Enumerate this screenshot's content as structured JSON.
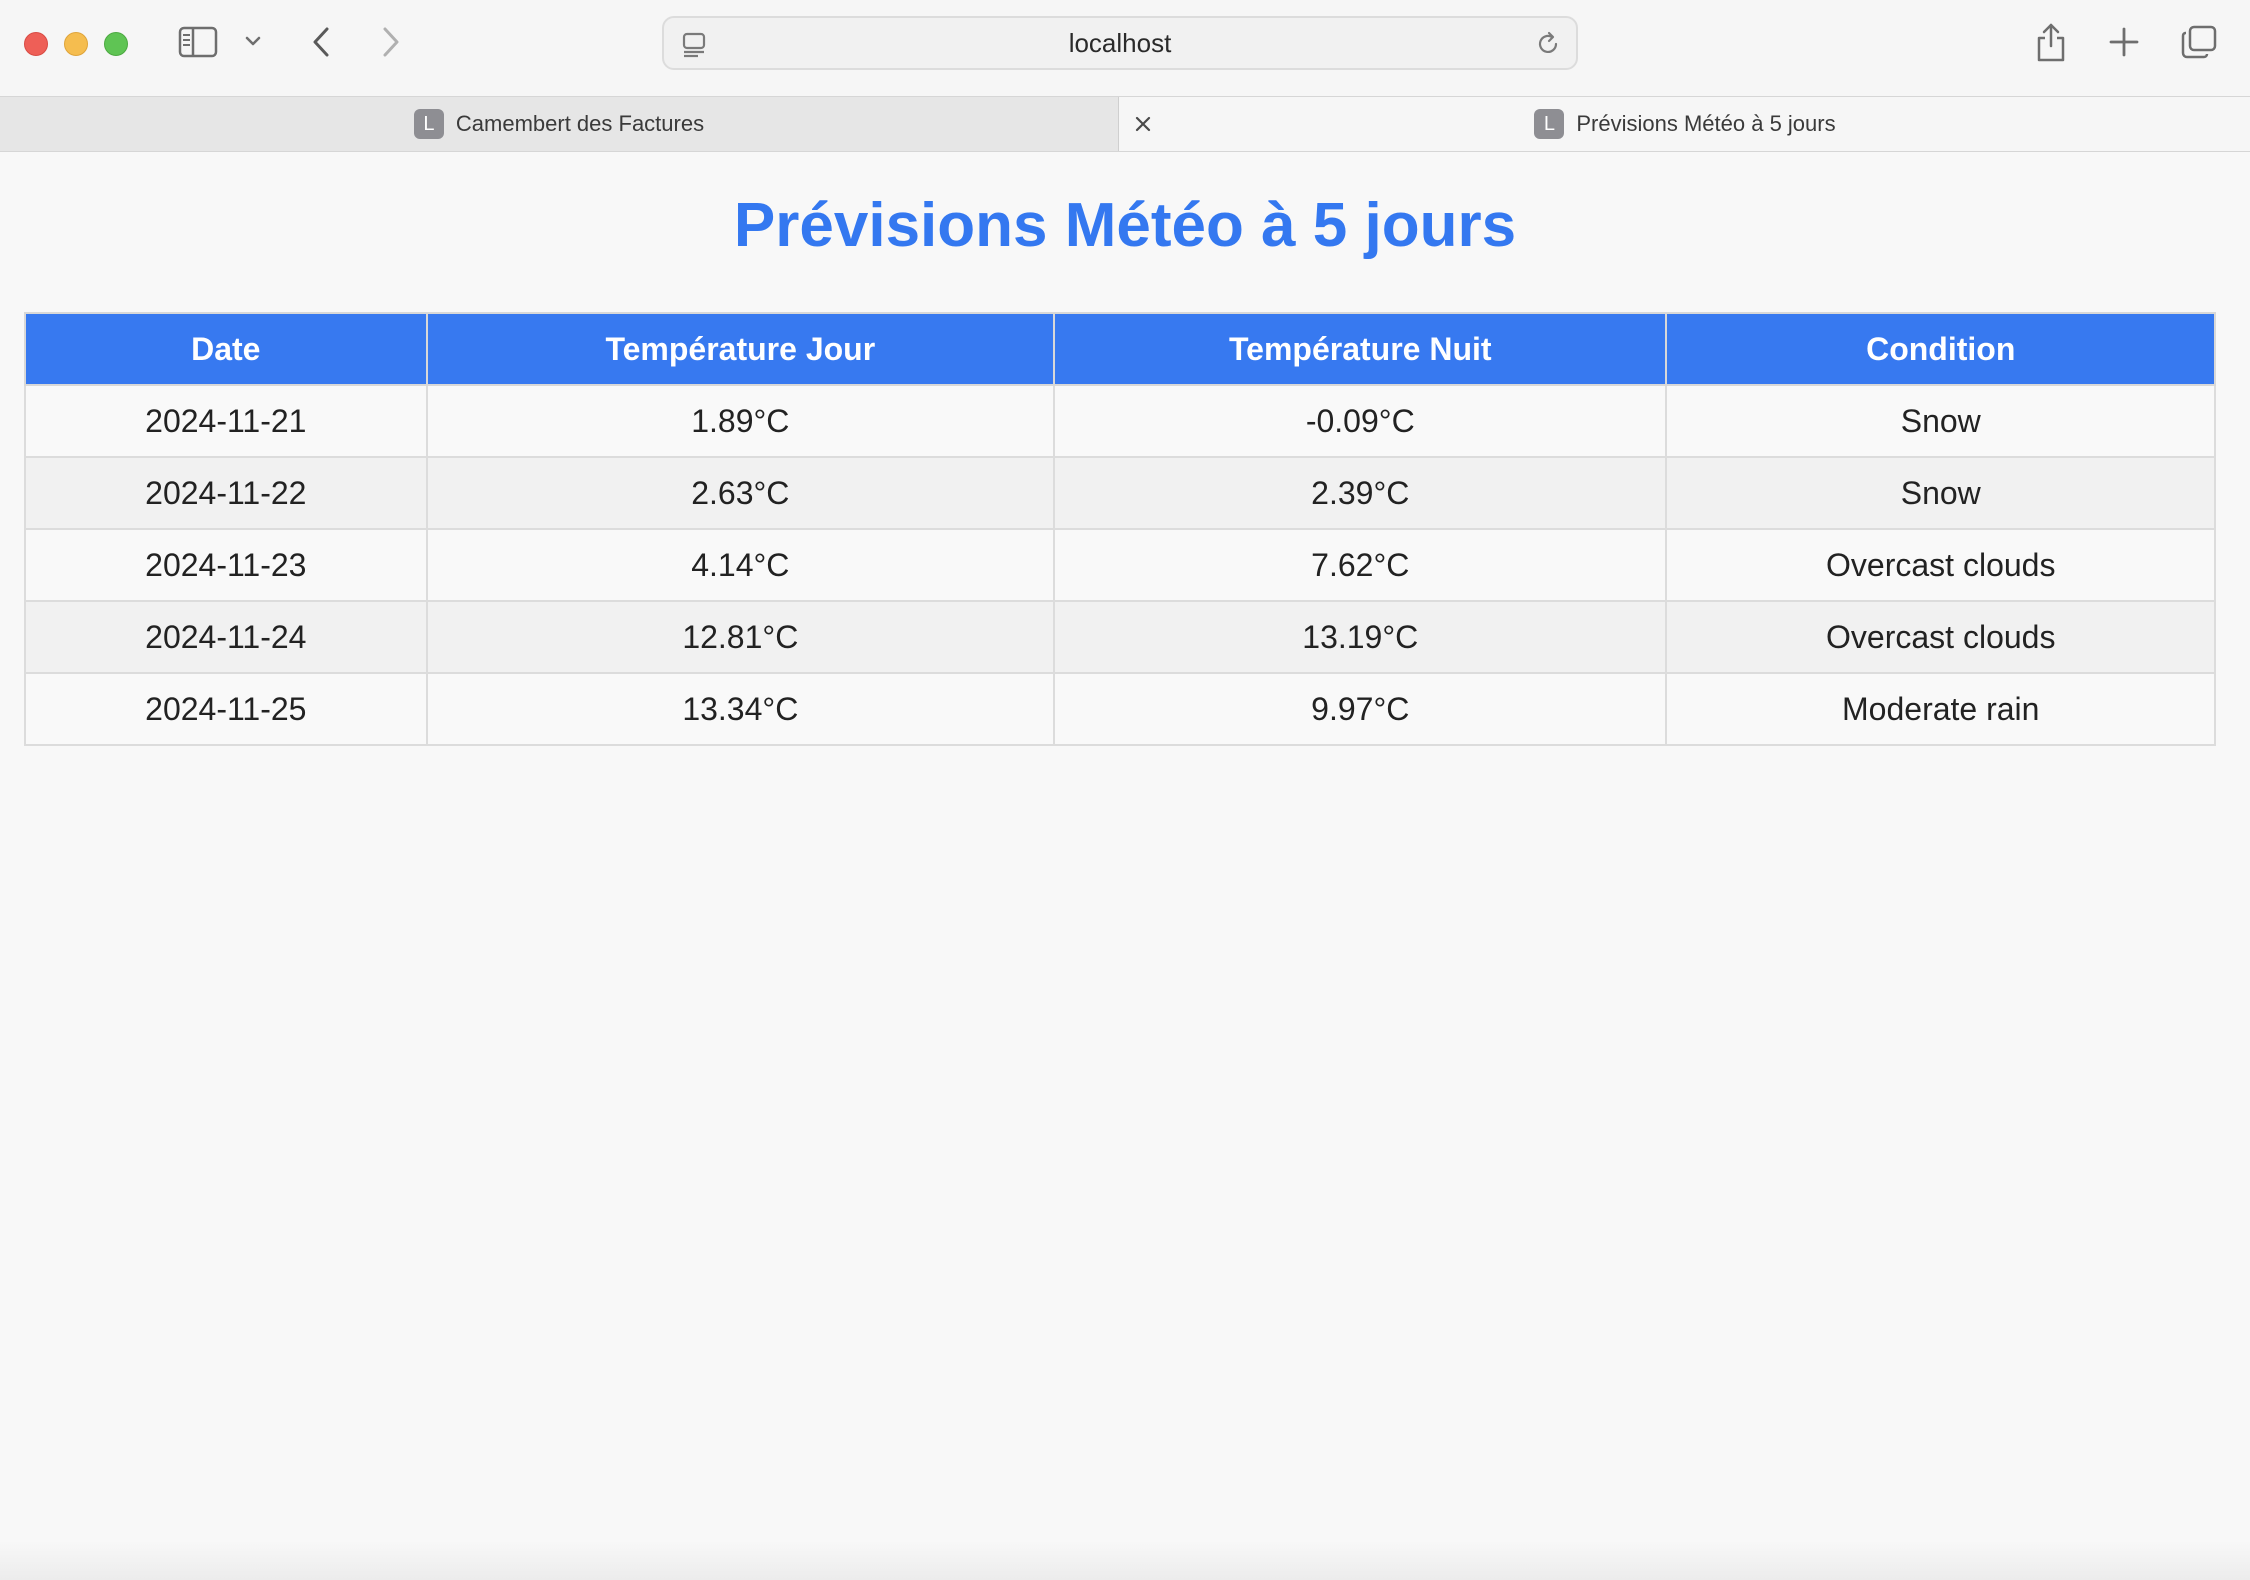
{
  "browser": {
    "url": "localhost",
    "tabs": [
      {
        "label": "Camembert des Factures",
        "favicon_letter": "L",
        "active": false
      },
      {
        "label": "Prévisions Météo à 5 jours",
        "favicon_letter": "L",
        "active": true
      }
    ],
    "colors": {
      "close": "#ee5f57",
      "minimize": "#f5bd4f",
      "maximize": "#5fc454"
    }
  },
  "page": {
    "title": "Prévisions Météo à 5 jours",
    "accent_color": "#3779f0",
    "table": {
      "headers": [
        "Date",
        "Température Jour",
        "Température Nuit",
        "Condition"
      ],
      "rows": [
        [
          "2024-11-21",
          "1.89°C",
          "-0.09°C",
          "Snow"
        ],
        [
          "2024-11-22",
          "2.63°C",
          "2.39°C",
          "Snow"
        ],
        [
          "2024-11-23",
          "4.14°C",
          "7.62°C",
          "Overcast clouds"
        ],
        [
          "2024-11-24",
          "12.81°C",
          "13.19°C",
          "Overcast clouds"
        ],
        [
          "2024-11-25",
          "13.34°C",
          "9.97°C",
          "Moderate rain"
        ]
      ]
    }
  }
}
